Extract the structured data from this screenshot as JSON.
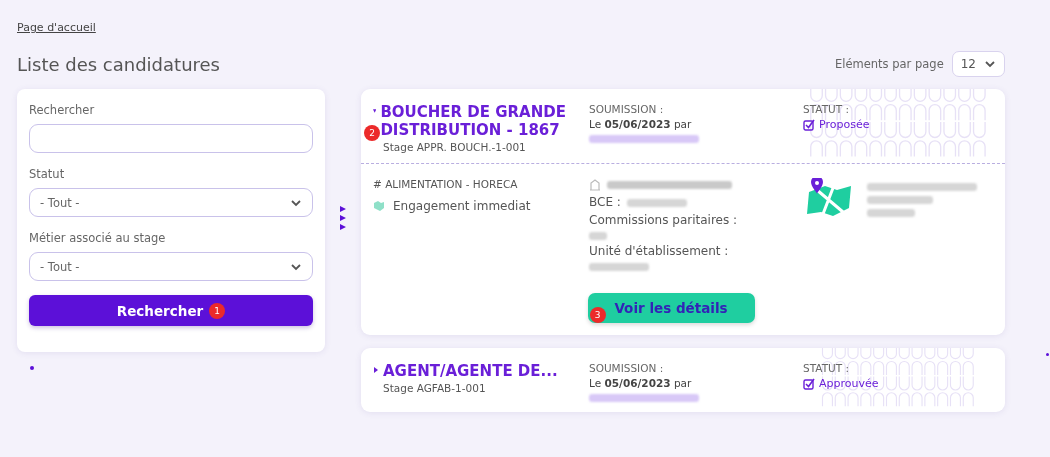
{
  "breadcrumb": "Page d'accueil",
  "title": "Liste des candidatures",
  "page_size": {
    "label": "Eléments par page",
    "value": "12"
  },
  "filters": {
    "fields": [
      {
        "kind": "text",
        "label": "Rechercher"
      },
      {
        "kind": "select",
        "label": "Statut",
        "value": "- Tout -"
      },
      {
        "kind": "select",
        "label": "Métier associé au stage",
        "value": "- Tout -"
      }
    ],
    "button": "Rechercher",
    "button_badge": "1"
  },
  "applications": [
    {
      "title": "BOUCHER DE GRANDE DISTRIBUTION - 1867",
      "expanded": true,
      "badge": "2",
      "subtitle": "Stage APPR. BOUCH.-1-001",
      "submission_label": "SOUMISSION :",
      "submission": "Le **05/06/2023** par",
      "status_label": "STATUT :",
      "status": "Proposée",
      "details": {
        "sector": "# ALIMENTATION - HORECA",
        "engagement": "Engagement immediat",
        "bce_label": "BCE :",
        "commissions_label": "Commissions paritaires :",
        "unit_label": "Unité d'établissement :",
        "button": "Voir les détails",
        "button_badge": "3"
      }
    },
    {
      "title": "AGENT/AGENTE DE...",
      "expanded": false,
      "subtitle": "Stage AGFAB-1-001",
      "submission_label": "SOUMISSION :",
      "submission": "Le **05/06/2023** par",
      "status_label": "STATUT :",
      "status": "Approuvée"
    }
  ]
}
